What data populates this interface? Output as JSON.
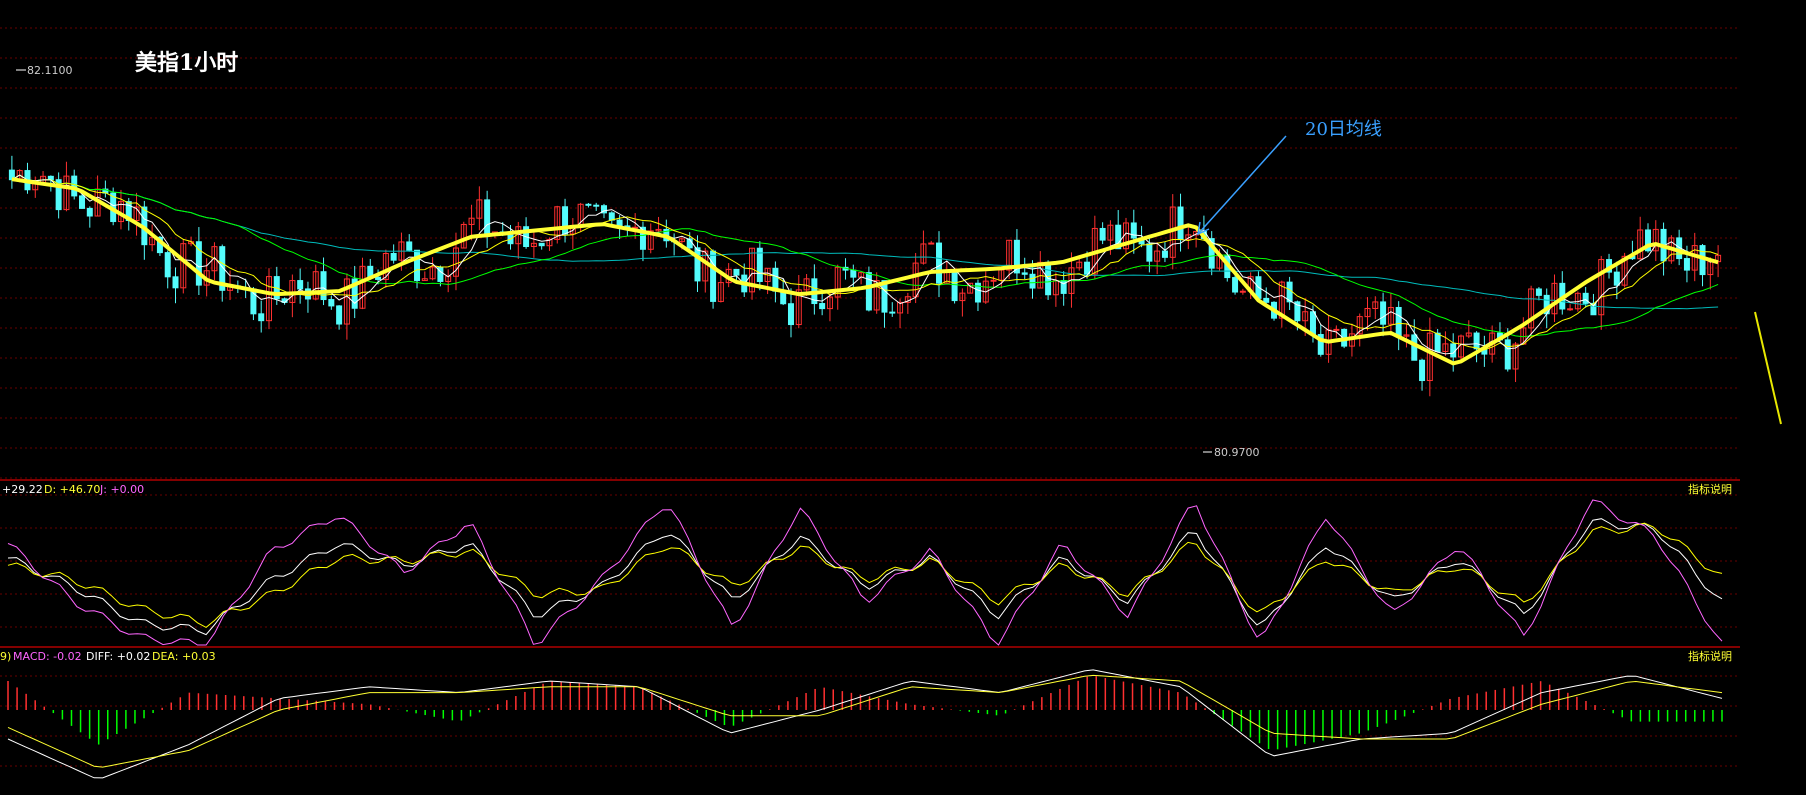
{
  "title": "美指1小时",
  "annotation": "20日均线",
  "price_high_label": "82.1100",
  "price_low_label": "80.9700",
  "kdj": {
    "k_label": "+29.22",
    "d_label": "D: +46.70",
    "j_label": "J: +0.00",
    "help": "指标说明"
  },
  "macd": {
    "prefix": "9)",
    "macd_label": "MACD: -0.02",
    "diff_label": "DIFF: +0.02",
    "dea_label": "DEA: +0.03",
    "help": "指标说明"
  },
  "colors": {
    "background": "#000000",
    "up": "#ff3030",
    "down": "#54fcfc",
    "ma20": "#ffff33",
    "ma5": "#ffffff",
    "ma10": "#ffff00",
    "ma30": "#00ff00",
    "ma60": "#00bbbb",
    "k": "#ffffff",
    "d": "#ffff00",
    "j": "#ff66ff",
    "grid": "#8b0000",
    "annotation": "#3aa0ff"
  },
  "chart_data": [
    {
      "type": "candlestick",
      "title": "美指1小时",
      "ylim": [
        80.87,
        82.2
      ],
      "high": 82.11,
      "low": 80.97,
      "ma20_close_path": [
        81.78,
        81.75,
        81.63,
        81.46,
        81.42,
        81.43,
        81.52,
        81.6,
        81.62,
        81.64,
        81.6,
        81.46,
        81.42,
        81.44,
        81.49,
        81.5,
        81.52,
        81.58,
        81.64,
        81.4,
        81.27,
        81.3,
        81.2,
        81.32,
        81.46,
        81.58,
        81.52
      ]
    },
    {
      "type": "line",
      "name": "KDJ",
      "ylim": [
        0,
        100
      ],
      "series": [
        {
          "name": "K",
          "values": [
            60,
            40,
            15,
            10,
            45,
            70,
            55,
            70,
            20,
            40,
            80,
            30,
            75,
            40,
            60,
            20,
            60,
            30,
            80,
            10,
            70,
            30,
            60,
            20,
            85,
            80,
            29.22
          ]
        },
        {
          "name": "D",
          "values": [
            55,
            45,
            25,
            15,
            35,
            60,
            58,
            65,
            35,
            38,
            70,
            40,
            68,
            45,
            58,
            30,
            55,
            35,
            72,
            20,
            60,
            35,
            55,
            28,
            78,
            82,
            46.7
          ]
        },
        {
          "name": "J",
          "values": [
            70,
            30,
            5,
            0,
            65,
            90,
            50,
            85,
            0,
            45,
            100,
            10,
            95,
            30,
            65,
            0,
            70,
            20,
            100,
            0,
            90,
            20,
            70,
            5,
            100,
            75,
            0
          ]
        }
      ]
    },
    {
      "type": "bar",
      "name": "MACD",
      "series": [
        {
          "name": "MACD",
          "values": [
            0.05,
            -0.06,
            0.03,
            0.02,
            0.01,
            -0.02,
            0.05,
            0.04,
            -0.03,
            0.04,
            0.01,
            -0.01,
            0.06,
            0.03,
            -0.07,
            -0.04,
            0.02,
            0.05,
            -0.02,
            -0.02
          ]
        },
        {
          "name": "DIFF",
          "values": [
            -0.05,
            -0.12,
            -0.06,
            0.02,
            0.04,
            0.03,
            0.05,
            0.04,
            -0.04,
            0.0,
            0.05,
            0.03,
            0.07,
            0.04,
            -0.08,
            -0.05,
            -0.04,
            0.03,
            0.06,
            0.02
          ]
        },
        {
          "name": "DEA",
          "values": [
            -0.03,
            -0.1,
            -0.07,
            0.0,
            0.03,
            0.03,
            0.04,
            0.04,
            -0.01,
            -0.01,
            0.04,
            0.03,
            0.06,
            0.05,
            -0.04,
            -0.05,
            -0.05,
            0.01,
            0.05,
            0.03
          ]
        }
      ]
    }
  ]
}
